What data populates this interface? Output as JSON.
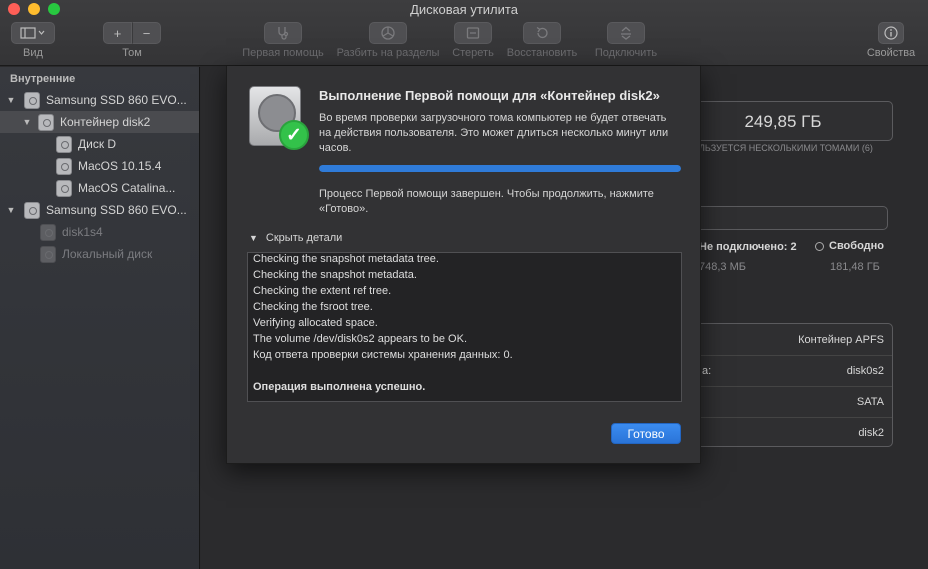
{
  "window": {
    "title": "Дисковая утилита"
  },
  "toolbar": {
    "view_label": "Вид",
    "volume_label": "Том",
    "volume_add": "+",
    "volume_remove": "−",
    "first_aid_label": "Первая помощь",
    "partition_label": "Разбить на разделы",
    "erase_label": "Стереть",
    "restore_label": "Восстановить",
    "mount_label": "Подключить",
    "info_label": "Свойства"
  },
  "sidebar": {
    "section_title": "Внутренние",
    "items": [
      {
        "label": "Samsung SSD 860 EVO..."
      },
      {
        "label": "Контейнер disk2"
      },
      {
        "label": "Диск D"
      },
      {
        "label": "MacOS 10.15.4"
      },
      {
        "label": "MacOS Catalina..."
      },
      {
        "label": "Samsung SSD 860 EVO..."
      },
      {
        "label": "disk1s4"
      },
      {
        "label": "Локальный диск"
      }
    ]
  },
  "background": {
    "capacity": "249,85 ГБ",
    "capacity_caption": "ЛЬЗУЕТСЯ НЕСКОЛЬКИМИ ТОМАМИ (6)",
    "not_mounted": "Не подключено: 2",
    "free_label": "Свободно",
    "not_mounted_size": "748,3 МБ",
    "free_size": "181,48 ГБ",
    "info_rows": [
      {
        "label": "",
        "value": "Контейнер APFS"
      },
      {
        "label": "а:",
        "value": "disk0s2"
      },
      {
        "label": "",
        "value": "SATA"
      },
      {
        "label": "",
        "value": "disk2"
      }
    ]
  },
  "dialog": {
    "title": "Выполнение Первой помощи для «Контейнер disk2»",
    "description": "Во время проверки загрузочного тома компьютер не будет отвечать на действия пользователя. Это может длиться несколько минут или часов.",
    "progress": 1.0,
    "status": "Процесс Первой помощи завершен. Чтобы продолжить, нажмите «Готово».",
    "details_toggle": "Скрыть детали",
    "log_lines": [
      "Checking the snapshot metadata tree.",
      "Checking the snapshot metadata.",
      "Checking the extent ref tree.",
      "Checking the fsroot tree.",
      "Verifying allocated space.",
      "The volume /dev/disk0s2 appears to be OK.",
      "Код ответа проверки системы хранения данных: 0.",
      "",
      "Операция выполнена успешно."
    ],
    "done_button": "Готово"
  },
  "colors": {
    "accent": "#2f7bd8",
    "check_green": "#33c24a",
    "close": "#fe5f57",
    "minimize": "#febc2e",
    "maximize": "#28c840"
  }
}
